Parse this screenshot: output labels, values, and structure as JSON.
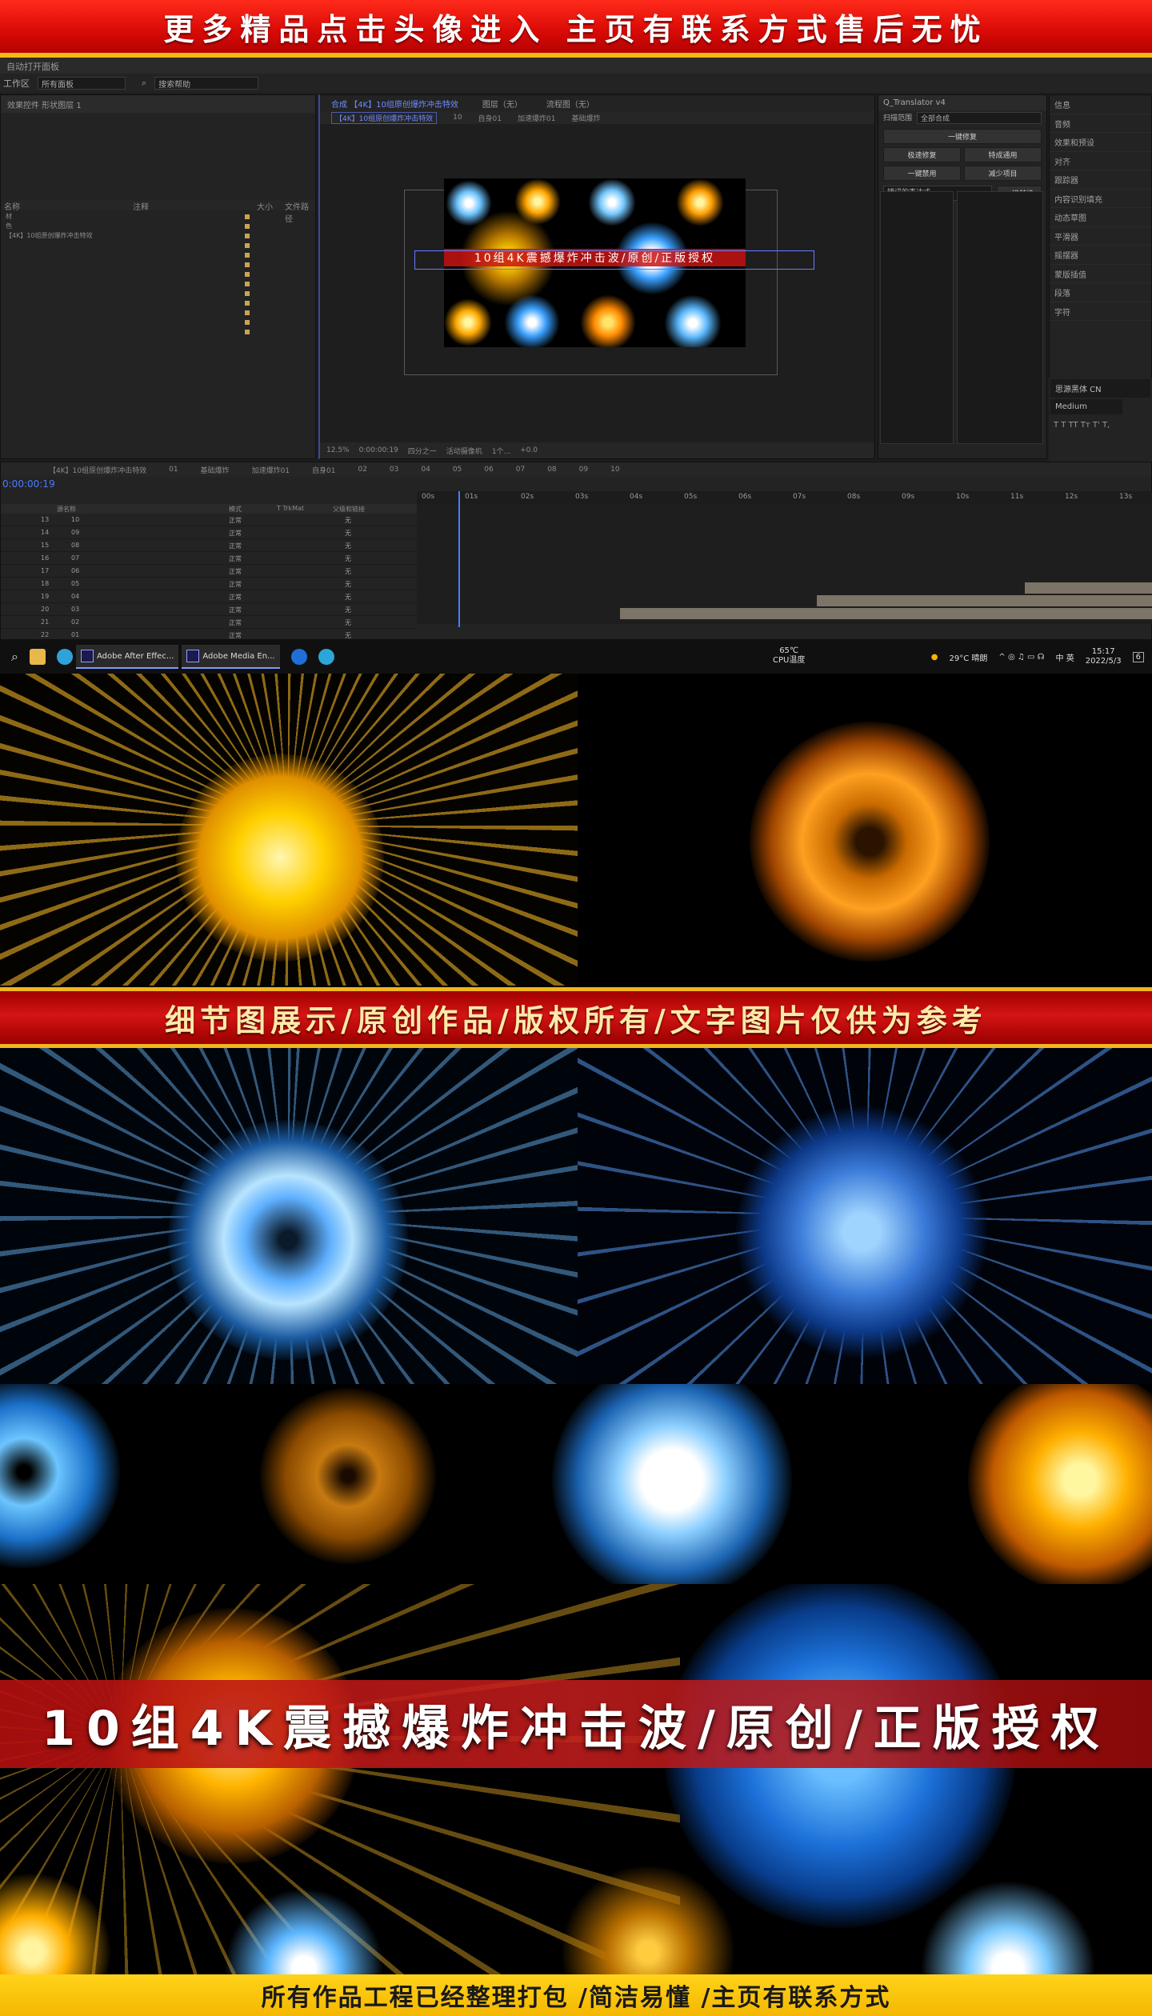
{
  "banner_top": "更多精品点击头像进入 主页有联系方式售后无忧",
  "ae": {
    "title": "自动打开面板",
    "workspace_label": "工作区",
    "workspace_value": "所有面板",
    "search_placeholder": "搜索帮助",
    "project_tab": "效果控件 形状图层 1",
    "project_columns": [
      "名称",
      "注释",
      "大小",
      "文件路径"
    ],
    "project_rows": [
      "材",
      "色",
      "【4K】10组原创爆炸冲击特效",
      "",
      "",
      "",
      "",
      "",
      "",
      "",
      "",
      "",
      ""
    ],
    "comp_tabs": [
      "合成 【4K】10组原创爆炸冲击特效",
      "图层（无）",
      "流程图（无）"
    ],
    "comp_crumbs": [
      "【4K】10组原创爆炸冲击特效",
      "10",
      "自身01",
      "加速爆炸01",
      "基础爆炸"
    ],
    "comp_overlay_title": "10组4K震撼爆炸冲击波/原创/正版授权",
    "comp_footer": [
      "12.5%",
      "0:00:00:19",
      "四分之一",
      "活动摄像机",
      "1个...",
      "+0.0"
    ],
    "translator": {
      "title": "Q_Translator v4",
      "scope_label": "扫描范围",
      "scope_value": "全部合成",
      "buttons": [
        "一键修复",
        "极速修复",
        "特成通用",
        "一键禁用",
        "减少项目",
        "一键替换"
      ],
      "expr_label": "错误的表达式"
    },
    "effects_list": [
      "信息",
      "音频",
      "效果和预设",
      "对齐",
      "跟踪器",
      "内容识别填充",
      "动态草图",
      "平滑器",
      "摇摆器",
      "蒙版插值",
      "段落",
      "字符"
    ],
    "char_font": "思源黑体 CN",
    "char_weight": "Medium",
    "timeline": {
      "time": "0:00:00:19",
      "tabs": [
        "【4K】10组原创爆炸冲击特效",
        "01",
        "基础爆炸",
        "加速爆炸01",
        "自身01",
        "02",
        "03",
        "04",
        "05",
        "06",
        "07",
        "08",
        "09",
        "10"
      ],
      "columns": [
        "源名称",
        "模式",
        "T TrkMat",
        "父级和链接"
      ],
      "ruler": [
        "00s",
        "01s",
        "02s",
        "03s",
        "04s",
        "05s",
        "06s",
        "07s",
        "08s",
        "09s",
        "10s",
        "11s",
        "12s",
        "13s"
      ],
      "layers": [
        {
          "num": "13",
          "name": "10",
          "mode": "正常",
          "parent": "无"
        },
        {
          "num": "14",
          "name": "09",
          "mode": "正常",
          "parent": "无"
        },
        {
          "num": "15",
          "name": "08",
          "mode": "正常",
          "parent": "无"
        },
        {
          "num": "16",
          "name": "07",
          "mode": "正常",
          "parent": "无"
        },
        {
          "num": "17",
          "name": "06",
          "mode": "正常",
          "parent": "无"
        },
        {
          "num": "18",
          "name": "05",
          "mode": "正常",
          "parent": "无"
        },
        {
          "num": "19",
          "name": "04",
          "mode": "正常",
          "parent": "无"
        },
        {
          "num": "20",
          "name": "03",
          "mode": "正常",
          "parent": "无"
        },
        {
          "num": "21",
          "name": "02",
          "mode": "正常",
          "parent": "无"
        },
        {
          "num": "22",
          "name": "01",
          "mode": "正常",
          "parent": "无"
        }
      ]
    }
  },
  "taskbar": {
    "apps": [
      "Adobe After Effec...",
      "Adobe Media En..."
    ],
    "cpu_temp": "65℃",
    "cpu_label": "CPU温度",
    "weather": "29°C 晴朗",
    "ime": "中 英",
    "clock_time": "15:17",
    "clock_date": "2022/5/3",
    "notif": "6"
  },
  "banner_mid": "细节图展示/原创作品/版权所有/文字图片仅供为参考",
  "headline": "10组4K震撼爆炸冲击波/原创/正版授权",
  "banner_bottom": "所有作品工程已经整理打包 /简洁易懂 /主页有联系方式",
  "colors": {
    "red": "#d80a06",
    "gold": "#f6b817",
    "ae_blue": "#4a7cff"
  }
}
